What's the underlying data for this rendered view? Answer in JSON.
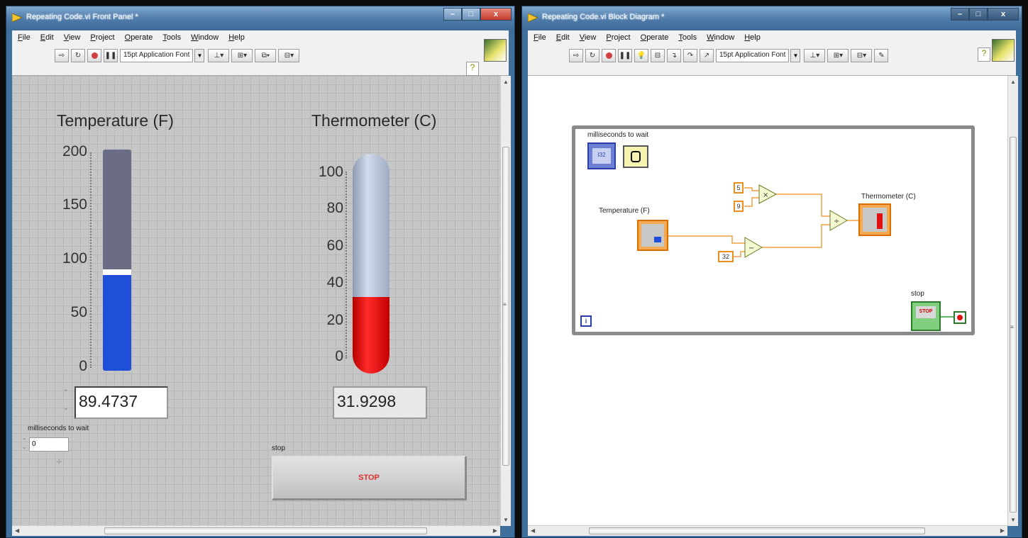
{
  "front_panel": {
    "window_title": "Repeating Code.vi Front Panel *",
    "menu": [
      "File",
      "Edit",
      "View",
      "Project",
      "Operate",
      "Tools",
      "Window",
      "Help"
    ],
    "toolbar": {
      "font": "15pt Application Font"
    },
    "temperature": {
      "label": "Temperature (F)",
      "scale": [
        "200",
        "150",
        "100",
        "50",
        "0"
      ],
      "value": "89.4737",
      "fill_fraction": 0.447
    },
    "thermometer": {
      "label": "Thermometer (C)",
      "scale": [
        "100",
        "80",
        "60",
        "40",
        "20",
        "0"
      ],
      "value": "31.9298",
      "fill_fraction": 0.319
    },
    "wait": {
      "label": "milliseconds to wait",
      "value": "0"
    },
    "stop": {
      "label": "stop",
      "button_text": "STOP"
    }
  },
  "block_diagram": {
    "window_title": "Repeating Code.vi Block Diagram *",
    "menu": [
      "File",
      "Edit",
      "View",
      "Project",
      "Operate",
      "Tools",
      "Window",
      "Help"
    ],
    "toolbar": {
      "font": "15pt Application Font"
    },
    "wait_label": "milliseconds to wait",
    "temperature_label": "Temperature (F)",
    "thermometer_label": "Thermometer (C)",
    "stop_label": "stop",
    "constants": [
      "5",
      "9",
      "32"
    ],
    "ops": {
      "multiply": "×",
      "subtract": "−",
      "divide": "÷"
    },
    "stop_terminal_text": "STOP",
    "wait_terminal_text": "I32"
  },
  "colors": {
    "temperature_fill": "#1f4fd9",
    "thermometer_fill": "#e01010",
    "thermometer_empty": "#b4c0d6",
    "wire_orange": "#f0a040"
  }
}
